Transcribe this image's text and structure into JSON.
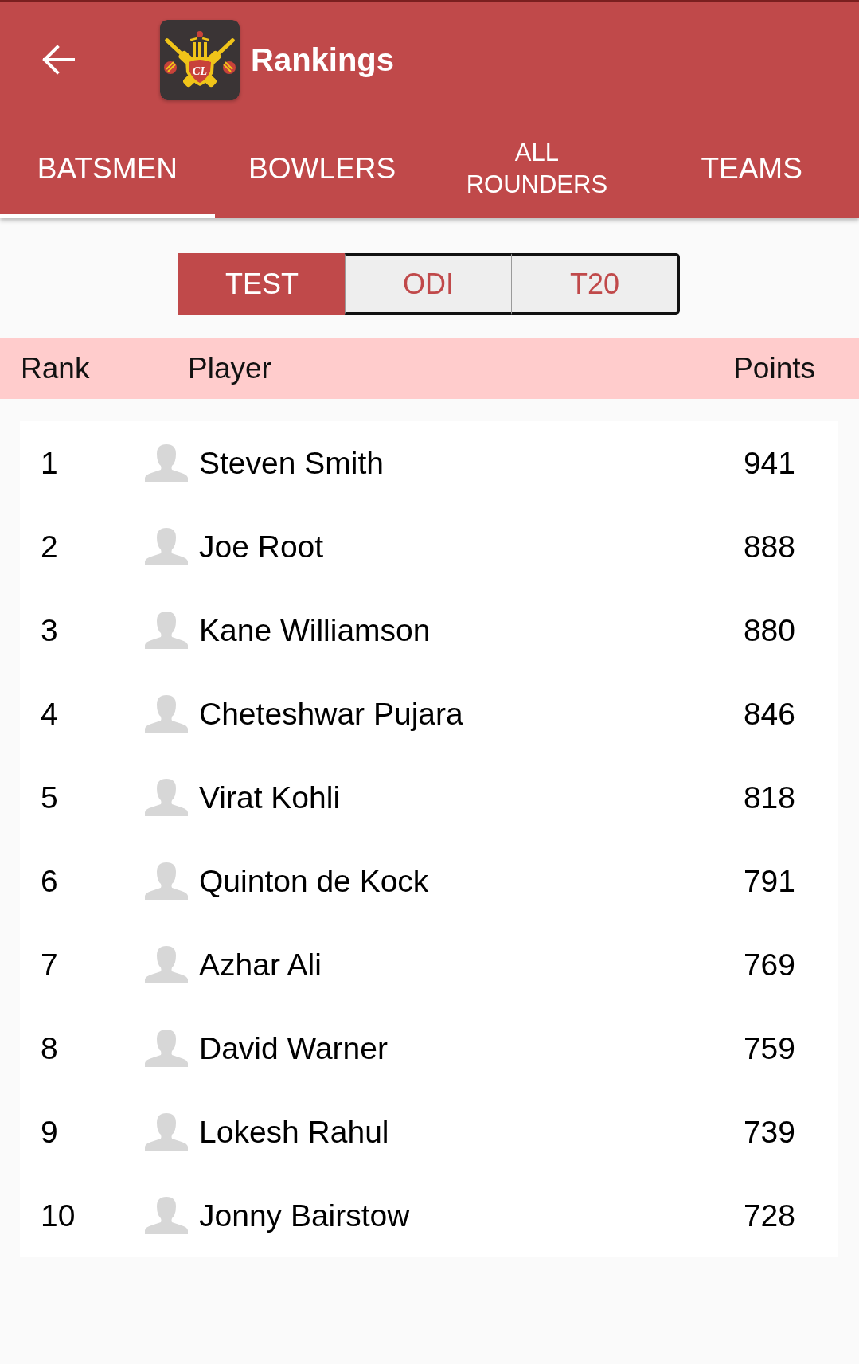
{
  "app_bar": {
    "title": "Rankings",
    "logo_text": "CL"
  },
  "tabs": [
    {
      "label": "BATSMEN",
      "selected": true
    },
    {
      "label": "BOWLERS",
      "selected": false
    },
    {
      "label": "ALL ROUNDERS",
      "selected": false
    },
    {
      "label": "TEAMS",
      "selected": false
    }
  ],
  "formats": [
    {
      "label": "TEST",
      "selected": true
    },
    {
      "label": "ODI",
      "selected": false
    },
    {
      "label": "T20",
      "selected": false
    }
  ],
  "table": {
    "columns": [
      "Rank",
      "Player",
      "Points"
    ],
    "rows": [
      {
        "rank": "1",
        "player": "Steven Smith",
        "points": "941"
      },
      {
        "rank": "2",
        "player": "Joe Root",
        "points": "888"
      },
      {
        "rank": "3",
        "player": "Kane Williamson",
        "points": "880"
      },
      {
        "rank": "4",
        "player": "Cheteshwar Pujara",
        "points": "846"
      },
      {
        "rank": "5",
        "player": "Virat Kohli",
        "points": "818"
      },
      {
        "rank": "6",
        "player": "Quinton de Kock",
        "points": "791"
      },
      {
        "rank": "7",
        "player": "Azhar Ali",
        "points": "769"
      },
      {
        "rank": "8",
        "player": "David Warner",
        "points": "759"
      },
      {
        "rank": "9",
        "player": "Lokesh Rahul",
        "points": "739"
      },
      {
        "rank": "10",
        "player": "Jonny Bairstow",
        "points": "728"
      }
    ]
  }
}
